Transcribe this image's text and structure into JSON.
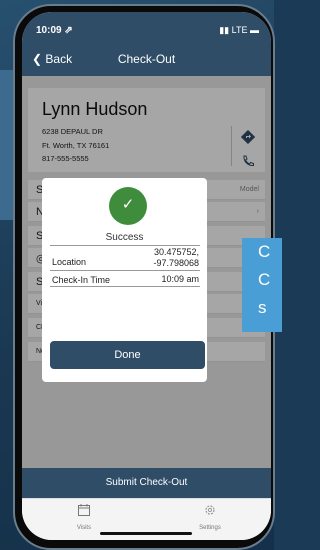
{
  "status_bar": {
    "time": "10:09 ⇗",
    "network": "LTE"
  },
  "nav": {
    "back_label": "Back",
    "title": "Check-Out"
  },
  "customer": {
    "name": "Lynn Hudson",
    "address_line1": "6238 DEPAUL DR",
    "address_line2": "Ft. Worth, TX 76161",
    "phone": "817-555-5555"
  },
  "rows": [
    {
      "label": "Ser",
      "right": "Model"
    },
    {
      "label": "Non",
      "right": ""
    },
    {
      "label": "Ser",
      "right": ""
    },
    {
      "label": "",
      "right": ""
    },
    {
      "label": "Ser",
      "right": ""
    },
    {
      "label": "Visit",
      "right": ""
    },
    {
      "label": "CFC",
      "right": ""
    },
    {
      "label": "Non-",
      "right": ""
    }
  ],
  "dialog": {
    "title": "Success",
    "location_label": "Location",
    "location_value_1": "30.475752,",
    "location_value_2": "-97.798068",
    "checkin_label": "Check-In Time",
    "checkin_value": "10:09 am",
    "done_label": "Done"
  },
  "tooltip": {
    "line1": "C",
    "line2": "C",
    "line3": "s"
  },
  "footer": {
    "submit_label": "Submit Check-Out"
  },
  "tabs": [
    {
      "label": "Visits",
      "icon": "calendar-icon"
    },
    {
      "label": "Settings",
      "icon": "gear-icon"
    }
  ]
}
